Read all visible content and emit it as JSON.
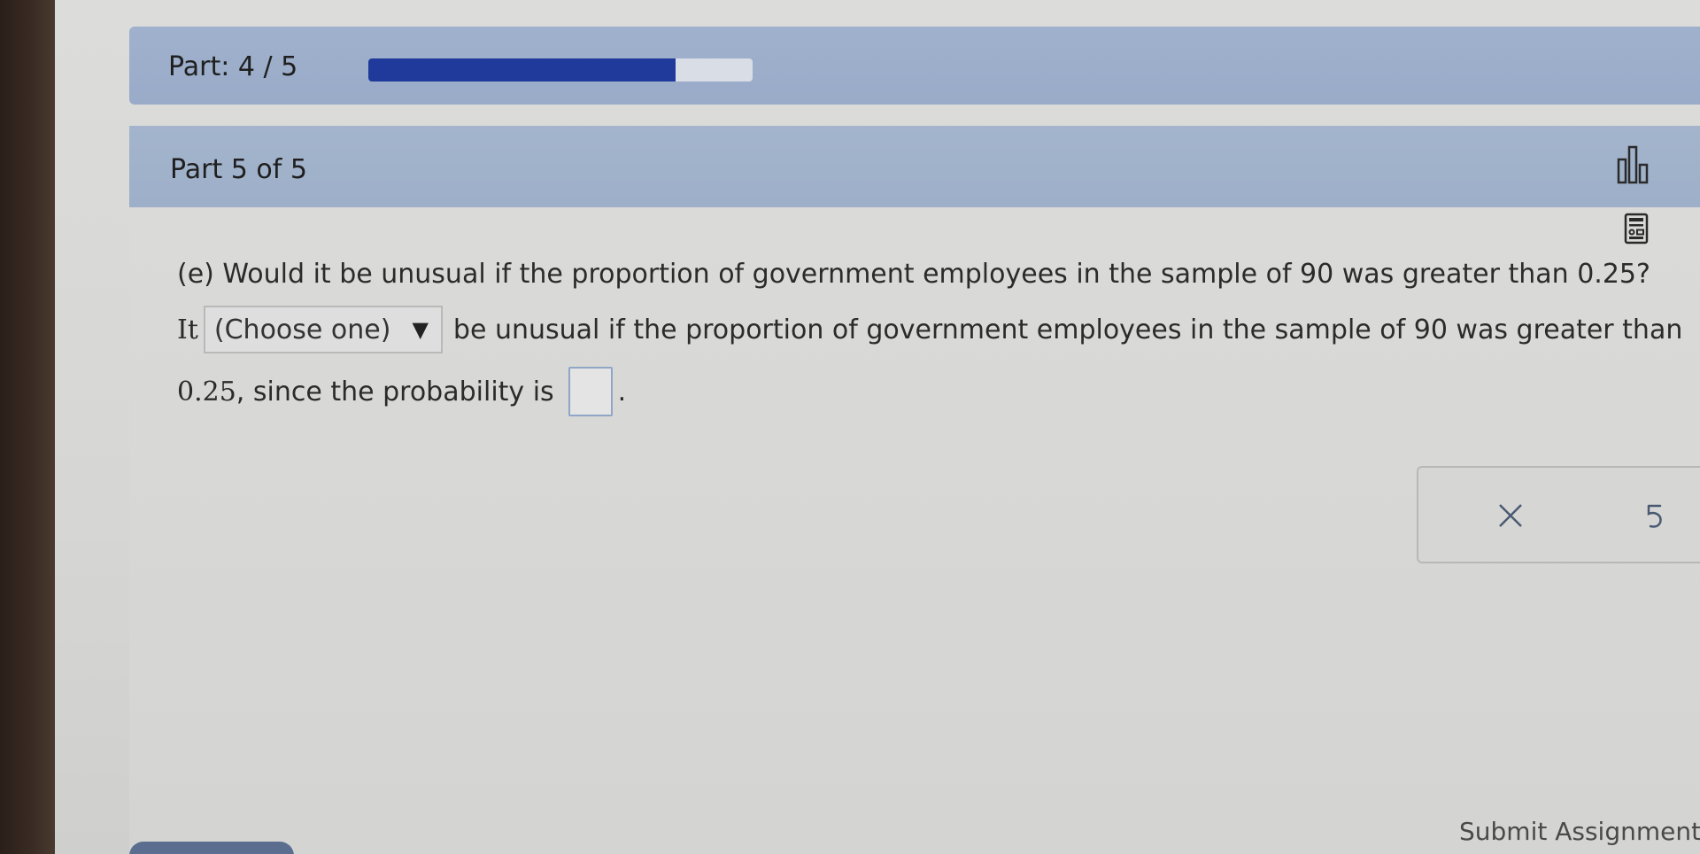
{
  "progress": {
    "label": "Part: 4 / 5",
    "fraction": 0.8
  },
  "section": {
    "title": "Part 5 of 5"
  },
  "question": {
    "prompt": "(e) Would it be unusual if the proportion of government employees in the sample of 90 was greater than 0.25?",
    "lead": "It",
    "dropdown_selected": "(Choose one)",
    "dropdown_arrow": "▼",
    "middle_text": "be unusual if the proportion of government employees in the sample of 90 was greater than",
    "threshold": "0.25",
    "end_text": ", since the probability is",
    "period": "."
  },
  "actions": {
    "clear_symbol": "×",
    "undo_symbol": "↺"
  },
  "footer": {
    "submit_label": "Submit Assignment"
  },
  "colors": {
    "progress_fill": "#1f3a9a",
    "header_bg": "#9fb1cc",
    "answer_border": "#8fa6c6"
  }
}
